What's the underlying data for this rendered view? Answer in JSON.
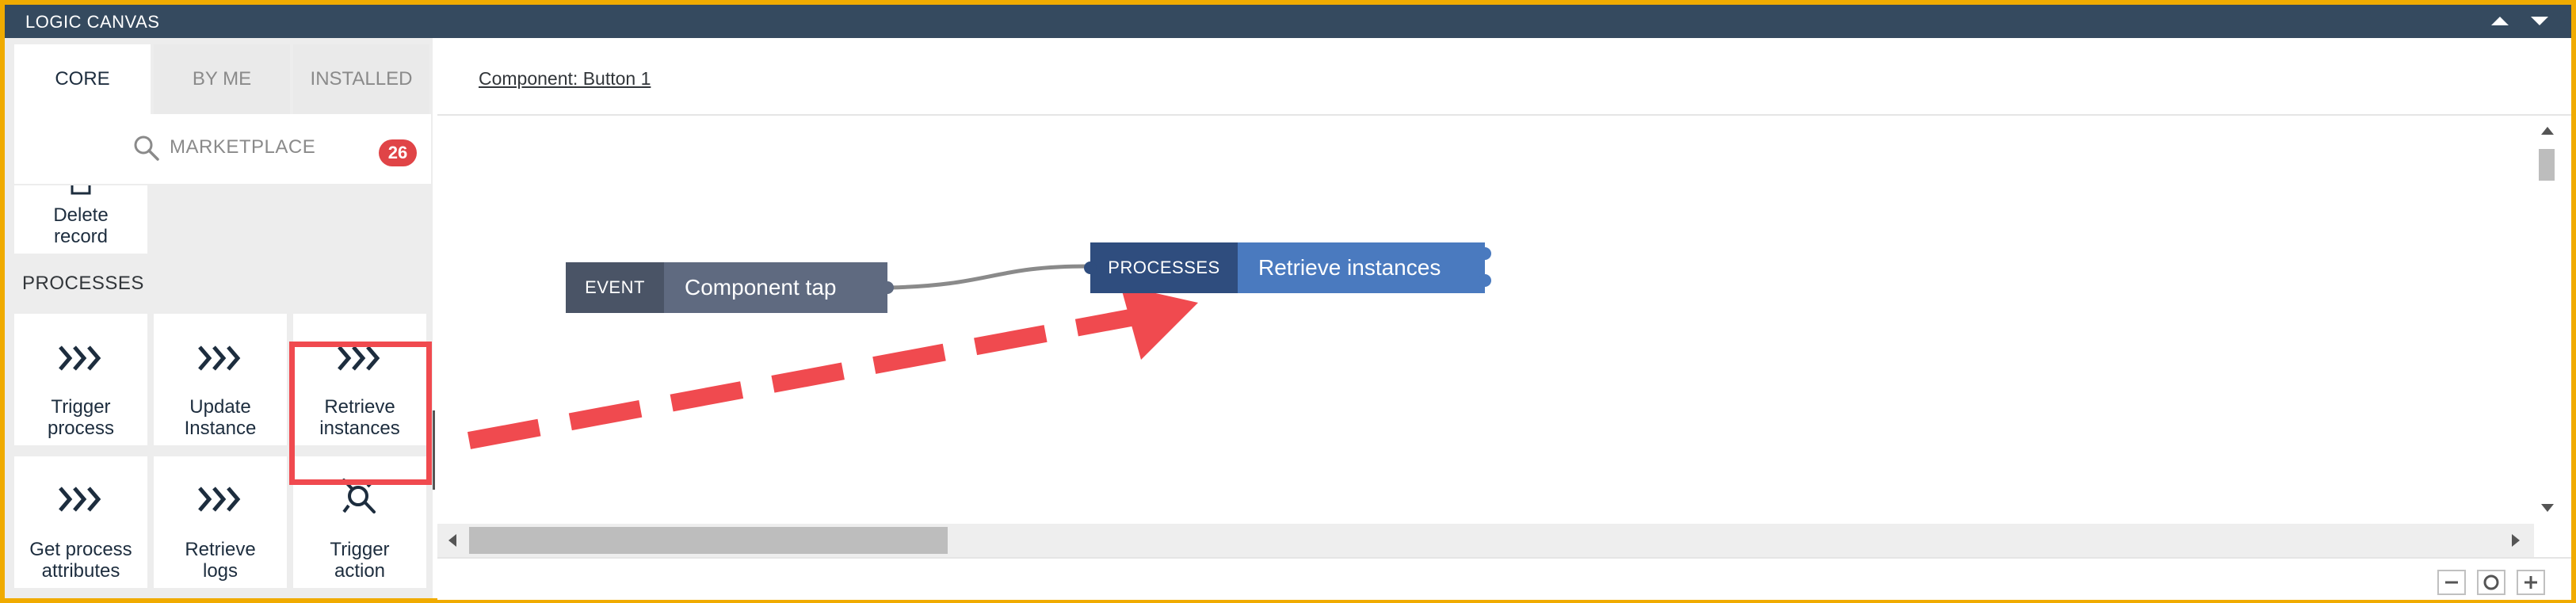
{
  "window": {
    "title": "LOGIC CANVAS"
  },
  "tabs": [
    {
      "label": "CORE",
      "active": true
    },
    {
      "label": "BY ME",
      "active": false
    },
    {
      "label": "INSTALLED",
      "active": false
    }
  ],
  "search": {
    "label": "MARKETPLACE",
    "badge": "26",
    "icon": "search-icon"
  },
  "tiles_top": [
    {
      "label_line1": "Delete",
      "label_line2": "record",
      "icon": "square-icon"
    }
  ],
  "section": {
    "processes_label": "PROCESSES"
  },
  "tiles": [
    {
      "label_line1": "Trigger",
      "label_line2": "process",
      "icon": "chevrons-icon"
    },
    {
      "label_line1": "Update",
      "label_line2": "Instance",
      "icon": "chevrons-icon"
    },
    {
      "label_line1": "Retrieve",
      "label_line2": "instances",
      "icon": "chevrons-icon",
      "highlighted": true
    },
    {
      "label_line1": "Get process",
      "label_line2": "attributes",
      "icon": "chevrons-icon"
    },
    {
      "label_line1": "Retrieve",
      "label_line2": "logs",
      "icon": "chevrons-icon"
    },
    {
      "label_line1": "Trigger",
      "label_line2": "action",
      "icon": "plug-icon"
    }
  ],
  "header": {
    "component_label": "Component: Button 1"
  },
  "canvas": {
    "event_node": {
      "tag": "EVENT",
      "label": "Component tap"
    },
    "process_node": {
      "tag": "PROCESSES",
      "label": "Retrieve instances"
    }
  },
  "colors": {
    "titlebar": "#354a5f",
    "border": "#f0ab00",
    "highlight": "#f04a4f",
    "event_tag": "#4a5466",
    "event_main": "#5f6a80",
    "process_tag": "#2f4d7e",
    "process_main": "#4a7abf",
    "badge": "#e04447"
  }
}
